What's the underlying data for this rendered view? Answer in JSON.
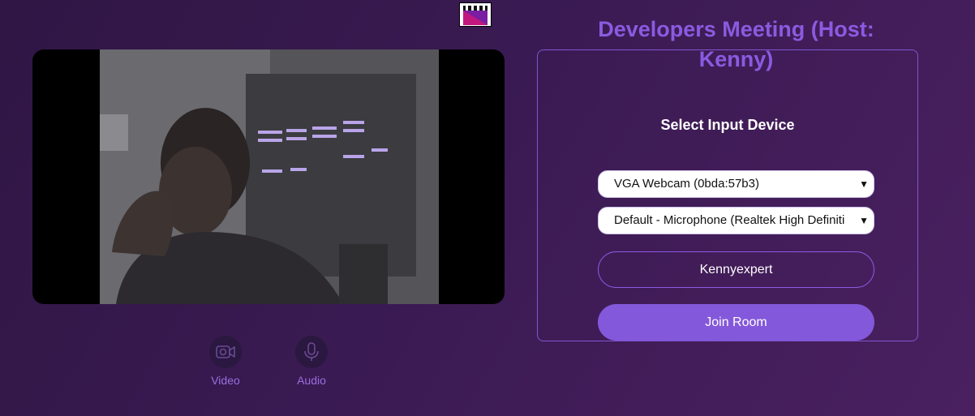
{
  "logo": {
    "icon": "clapperboard-icon"
  },
  "preview": {
    "description_icon": "camera-preview"
  },
  "controls": {
    "video_label": "Video",
    "audio_label": "Audio",
    "video_icon": "video-camera-icon",
    "audio_icon": "microphone-icon"
  },
  "meeting": {
    "title": "Developers Meeting (Host: Kenny)"
  },
  "device_panel": {
    "heading": "Select Input Device",
    "camera_selected": "VGA Webcam (0bda:57b3)",
    "microphone_selected": "Default - Microphone (Realtek High Definiti",
    "name_value": "Kennyexpert",
    "join_label": "Join Room"
  },
  "colors": {
    "accent": "#8458db",
    "title": "#8a5be0",
    "background": "#3a1a52"
  }
}
